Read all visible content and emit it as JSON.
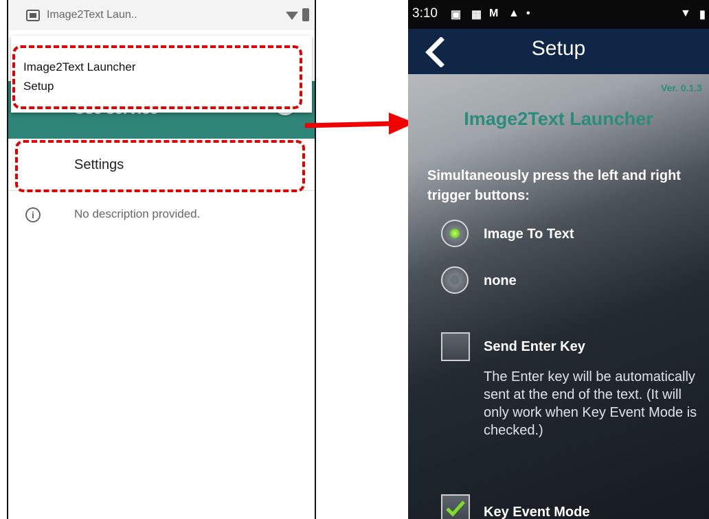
{
  "left": {
    "status_title": "Image2Text Laun..",
    "use_service_label": "Use service",
    "notification": {
      "title": "Image2Text Launcher",
      "subtitle": "Setup"
    },
    "settings_label": "Settings",
    "description": "No description provided.",
    "icons": [
      "app-icon",
      "wifi-icon",
      "battery-icon",
      "info-icon"
    ]
  },
  "right": {
    "status_time": "3:10",
    "nav_title": "Setup",
    "version": "Ver. 0.1.3",
    "app_title": "Image2Text Launcher",
    "prompt": "Simultaneously press the left and right trigger buttons:",
    "options": [
      {
        "label": "Image To Text",
        "selected": true
      },
      {
        "label": "none",
        "selected": false
      }
    ],
    "send_enter": {
      "label": "Send Enter Key",
      "checked": false,
      "description": "The Enter key will be automatically sent at the end of the text. (It will only work when Key Event Mode is checked.)"
    },
    "key_event": {
      "label": "Key Event Mode",
      "checked": true
    }
  },
  "colors": {
    "highlight": "#e00000",
    "teal": "#2f8577",
    "nav": "#0f2647",
    "accent_text": "#2a8c7c"
  }
}
